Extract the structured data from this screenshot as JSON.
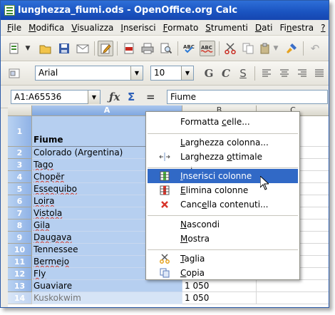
{
  "window": {
    "title": "lunghezza_fiumi.ods - OpenOffice.org Calc"
  },
  "menubar": [
    {
      "pre": "",
      "mn": "F",
      "post": "ile"
    },
    {
      "pre": "",
      "mn": "M",
      "post": "odifica"
    },
    {
      "pre": "",
      "mn": "V",
      "post": "isualizza"
    },
    {
      "pre": "",
      "mn": "I",
      "post": "nserisci"
    },
    {
      "pre": "",
      "mn": "F",
      "post": "ormato"
    },
    {
      "pre": "",
      "mn": "S",
      "post": "trumenti"
    },
    {
      "pre": "",
      "mn": "D",
      "post": "ati"
    },
    {
      "pre": "Fi",
      "mn": "n",
      "post": "estra"
    },
    {
      "pre": "",
      "mn": "?",
      "post": ""
    }
  ],
  "format_bar": {
    "font_name": "Arial",
    "font_size": "10"
  },
  "formula_bar": {
    "name_box": "A1:A65536",
    "formula": "Fiume"
  },
  "columns": {
    "a": "A",
    "b": "B",
    "c": "C"
  },
  "rows": [
    {
      "num": "1",
      "a": "Fiume",
      "b": ""
    },
    {
      "num": "2",
      "a": "Colorado (Argentina)",
      "b": ""
    },
    {
      "num": "3",
      "a": "Tago",
      "b": ""
    },
    {
      "num": "4",
      "a": "Chopër",
      "b": ""
    },
    {
      "num": "5",
      "a": "Essequibo",
      "b": ""
    },
    {
      "num": "6",
      "a": "Loira",
      "b": ""
    },
    {
      "num": "7",
      "a": "Vistola",
      "b": ""
    },
    {
      "num": "8",
      "a": "Gila",
      "b": ""
    },
    {
      "num": "9",
      "a": "Daugava",
      "b": ""
    },
    {
      "num": "10",
      "a": "Tennessee",
      "b": ""
    },
    {
      "num": "11",
      "a": "Bermejo",
      "b": ""
    },
    {
      "num": "12",
      "a": "Fly",
      "b": ""
    },
    {
      "num": "13",
      "a": "Guaviare",
      "b": "1 050"
    },
    {
      "num": "14",
      "a": "Kuskokwim",
      "b": "1 050"
    }
  ],
  "context_menu": {
    "formatta": {
      "pre": "Formatta ",
      "mn": "c",
      "post": "elle..."
    },
    "larghezza": {
      "pre": "",
      "mn": "L",
      "post": "arghezza colonna..."
    },
    "ottimale": {
      "pre": "Larghezza ",
      "mn": "o",
      "post": "ttimale colonna..."
    },
    "inserisci": {
      "pre": "",
      "mn": "I",
      "post": "nserisci colonne"
    },
    "elimina": {
      "pre": "",
      "mn": "E",
      "post": "limina colonne"
    },
    "cancella": {
      "pre": "Canc",
      "mn": "e",
      "post": "lla contenuti..."
    },
    "nascondi": {
      "pre": "",
      "mn": "N",
      "post": "ascondi"
    },
    "mostra": {
      "pre": "",
      "mn": "M",
      "post": "ostra"
    },
    "taglia": {
      "pre": "",
      "mn": "T",
      "post": "aglia"
    },
    "copia": {
      "pre": "",
      "mn": "C",
      "post": "opia"
    }
  },
  "colors": {
    "title_bar": "#1a53c0",
    "highlight": "#3169c6",
    "selected_column": "#b6cff0"
  }
}
